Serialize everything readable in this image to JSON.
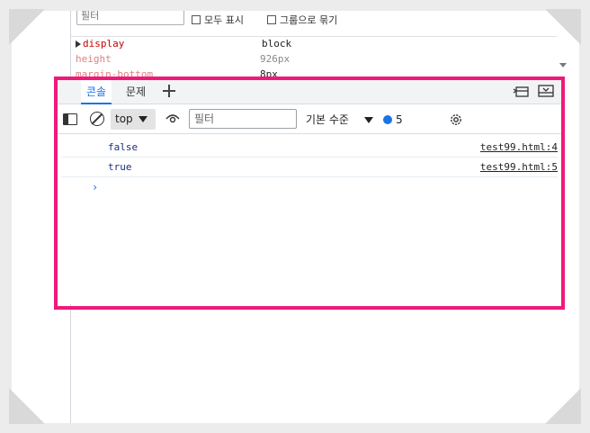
{
  "styles_panel": {
    "filter_placeholder": "필터",
    "checkbox_show_all": "모두 표시",
    "checkbox_group": "그룹으로 묶기",
    "properties": [
      {
        "name": "display",
        "value": "block",
        "expandable": true
      },
      {
        "name": "height",
        "value": "926px",
        "expandable": false
      },
      {
        "name": "margin-bottom",
        "value": "8px",
        "expandable": false
      }
    ]
  },
  "console": {
    "tabs": [
      {
        "label": "콘솔",
        "active": true
      },
      {
        "label": "문제",
        "active": false
      }
    ],
    "toolbar": {
      "context": "top",
      "filter_placeholder": "필터",
      "level_label": "기본 수준",
      "issues_count": "5"
    },
    "logs": [
      {
        "message": "false",
        "source": "test99.html:4"
      },
      {
        "message": "true",
        "source": "test99.html:5"
      }
    ],
    "prompt": "›"
  },
  "colors": {
    "highlight": "#f0197a",
    "accent": "#1a73e8"
  }
}
